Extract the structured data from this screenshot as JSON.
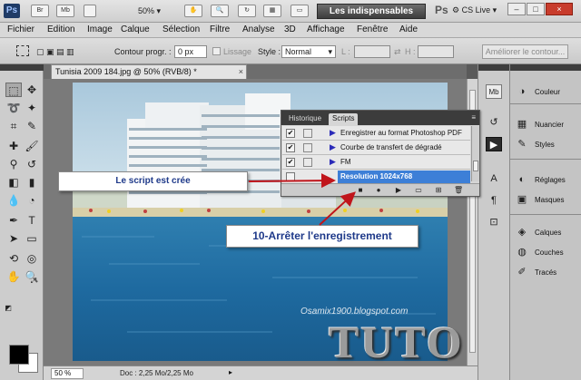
{
  "app": {
    "logo": "Ps",
    "bridge_label": "Br",
    "minibridge_label": "Mb",
    "zoom": "50%",
    "workspace_button": "Les indispensables",
    "ps_mini": "Ps",
    "cs_live": "CS Live",
    "window_minimize": "–",
    "window_restore": "□",
    "window_close": "×"
  },
  "menu": [
    "Fichier",
    "Edition",
    "Image",
    "Calque",
    "Sélection",
    "Filtre",
    "Analyse",
    "3D",
    "Affichage",
    "Fenêtre",
    "Aide"
  ],
  "options": {
    "contour_label": "Contour progr. :",
    "contour_value": "0 px",
    "lissage_label": "Lissage",
    "style_label": "Style :",
    "style_value": "Normal",
    "refine_button": "Améliorer le contour..."
  },
  "document": {
    "tab_title": "Tunisia 2009 184.jpg @ 50% (RVB/8) *",
    "tab_close": "×",
    "status_zoom": "50 %",
    "status_info": "Doc : 2,25 Mo/2,25 Mo"
  },
  "scripts_panel": {
    "tabs": [
      "Historique",
      "Scripts"
    ],
    "active_tab": "Scripts",
    "rows": [
      {
        "label": "Enregistrer au format Photoshop PDF",
        "checked": true,
        "selected": false
      },
      {
        "label": "Courbe de transfert de dégradé",
        "checked": true,
        "selected": false
      },
      {
        "label": "FM",
        "checked": true,
        "selected": false
      },
      {
        "label": "Resolution 1024x768",
        "checked": false,
        "selected": true
      }
    ],
    "check_glyph": "✔"
  },
  "right_panels": [
    {
      "icon": "couleur-icon",
      "label": "Couleur"
    },
    {
      "icon": "nuancier-icon",
      "label": "Nuancier"
    },
    {
      "icon": "styles-icon",
      "label": "Styles"
    },
    {
      "icon": "reglages-icon",
      "label": "Réglages"
    },
    {
      "icon": "masques-icon",
      "label": "Masques"
    },
    {
      "icon": "calques-icon",
      "label": "Calques"
    },
    {
      "icon": "couches-icon",
      "label": "Couches"
    },
    {
      "icon": "traces-icon",
      "label": "Tracés"
    }
  ],
  "callouts": {
    "script_created": "Le script est crée",
    "stop_recording": "10-Arrêter l'enregistrement"
  },
  "overlay": {
    "watermark": "Osamix1900.blogspot.com",
    "tuto": "TUTO"
  },
  "colors": {
    "accent_selection": "#3d7fd7",
    "callout_text": "#1f3a8a",
    "arrow": "#c0151b"
  }
}
